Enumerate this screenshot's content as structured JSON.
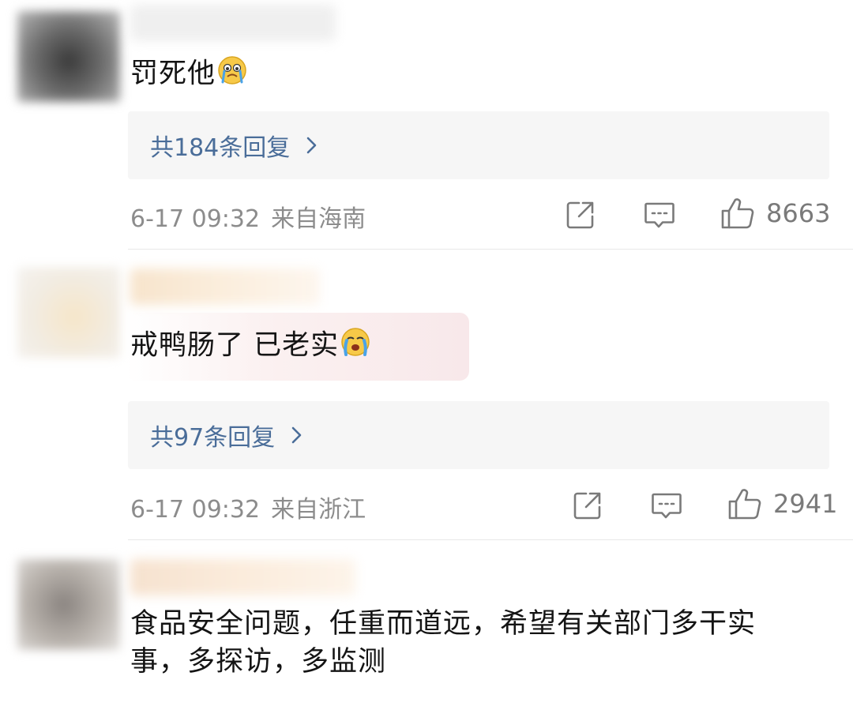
{
  "comments": [
    {
      "text": "罚死他",
      "emoji": "crying-face-icon",
      "replies_label": "共184条回复",
      "date": "6-17 09:32",
      "location": "来自海南",
      "likes": "8663"
    },
    {
      "text": "戒鸭肠了 已老实",
      "emoji": "loudly-crying-face-icon",
      "replies_label": "共97条回复",
      "date": "6-17 09:32",
      "location": "来自浙江",
      "likes": "2941"
    },
    {
      "text_line1": "食品安全问题，任重而道远，希望有关部门多干实",
      "text_line2": "事，多探访，多监测"
    }
  ],
  "colors": {
    "link": "#4a6d99",
    "meta": "#8c8c8c",
    "reply_bg": "#f6f6f6"
  }
}
